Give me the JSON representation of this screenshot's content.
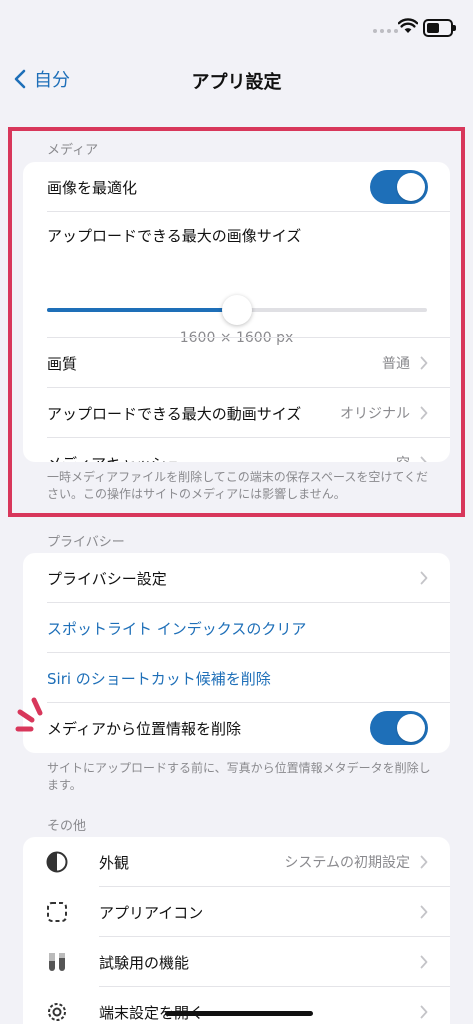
{
  "nav": {
    "back_label": "自分",
    "title": "アプリ設定"
  },
  "media": {
    "header": "メディア",
    "optimize_label": "画像を最適化",
    "optimize_on": true,
    "max_image_label": "アップロードできる最大の画像サイズ",
    "max_image_value": "1600 × 1600 px",
    "max_image_fraction": 0.5,
    "quality_label": "画質",
    "quality_value": "普通",
    "max_video_label": "アップロードできる最大の動画サイズ",
    "max_video_value": "オリジナル",
    "cache_label": "メディアキャッシュ",
    "cache_value": "空",
    "footer": "一時メディアファイルを削除してこの端末の保存スペースを空けてください。この操作はサイトのメディアには影響しません。"
  },
  "privacy": {
    "header": "プライバシー",
    "settings_label": "プライバシー設定",
    "spotlight_label": "スポットライト インデックスのクリア",
    "siri_label": "Siri のショートカット候補を削除",
    "location_label": "メディアから位置情報を削除",
    "location_on": true,
    "footer": "サイトにアップロードする前に、写真から位置情報メタデータを削除します。"
  },
  "other": {
    "header": "その他",
    "appearance_label": "外観",
    "appearance_value": "システムの初期設定",
    "app_icon_label": "アプリアイコン",
    "experimental_label": "試験用の機能",
    "device_settings_label": "端末設定を開く"
  },
  "colors": {
    "accent": "#1e6fb8",
    "highlight": "#d8375b",
    "background": "#f2f2f7"
  }
}
